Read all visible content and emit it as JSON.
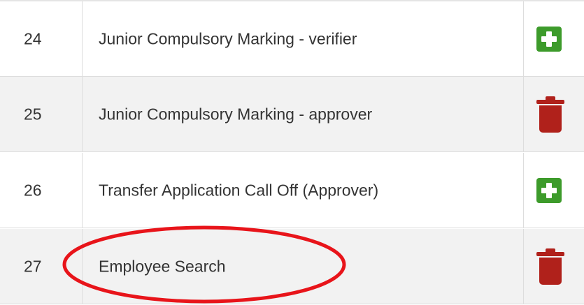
{
  "rows": [
    {
      "number": "24",
      "name": "Junior Compulsory Marking - verifier",
      "action": "add",
      "action_icon": "plus-icon",
      "stripe": "odd"
    },
    {
      "number": "25",
      "name": "Junior Compulsory Marking - approver",
      "action": "delete",
      "action_icon": "trash-icon",
      "stripe": "even"
    },
    {
      "number": "26",
      "name": "Transfer Application Call Off (Approver)",
      "action": "add",
      "action_icon": "plus-icon",
      "stripe": "odd"
    },
    {
      "number": "27",
      "name": "Employee Search",
      "action": "delete",
      "action_icon": "trash-icon",
      "stripe": "even"
    }
  ],
  "colors": {
    "add_green": "#3d9b2b",
    "delete_red": "#b0211b",
    "annotation_red": "#e8141a",
    "stripe_gray": "#f2f2f2",
    "text": "#333333"
  },
  "annotation": {
    "shape": "ellipse",
    "highlights": "Employee Search"
  }
}
